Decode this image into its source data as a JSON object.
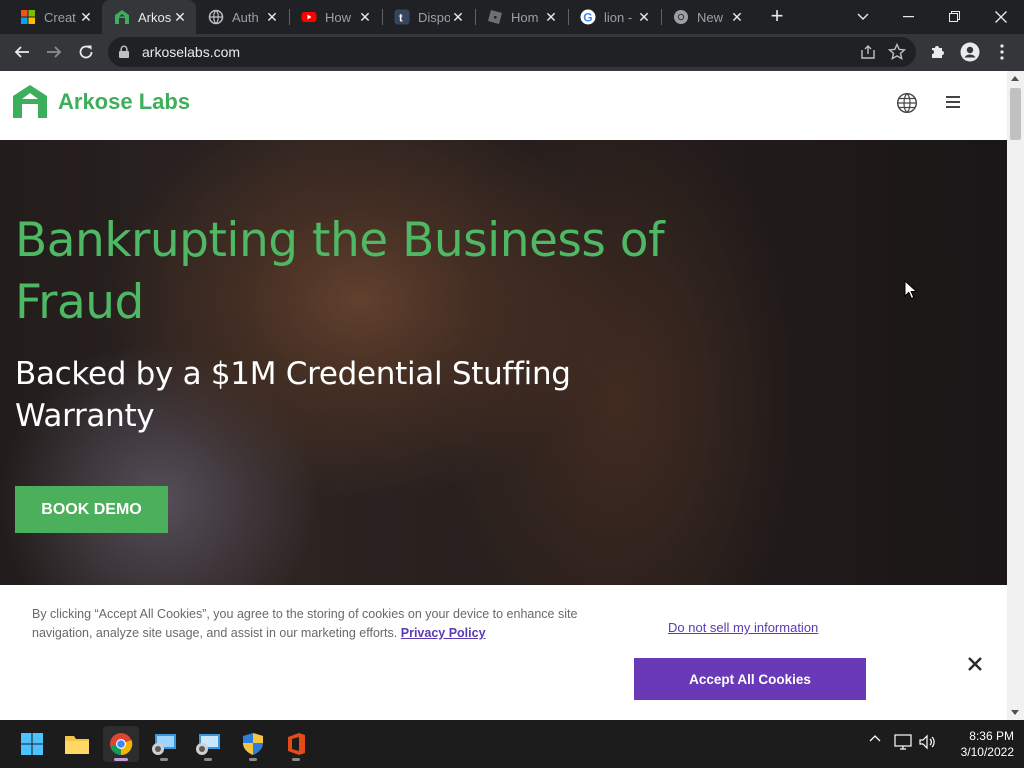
{
  "browser": {
    "tabs": [
      {
        "title": "Creat",
        "favicon": "microsoft-icon",
        "active": false
      },
      {
        "title": "Arkos",
        "favicon": "arkose-icon",
        "active": true
      },
      {
        "title": "Auth",
        "favicon": "globe-icon",
        "active": false
      },
      {
        "title": "How",
        "favicon": "youtube-icon",
        "active": false
      },
      {
        "title": "Dispo",
        "favicon": "tumblr-icon",
        "active": false
      },
      {
        "title": "Hom",
        "favicon": "roblox-icon",
        "active": false
      },
      {
        "title": "lion -",
        "favicon": "google-icon",
        "active": false
      },
      {
        "title": "New",
        "favicon": "chrome-icon",
        "active": false
      }
    ],
    "url": "arkoselabs.com"
  },
  "site": {
    "brand": "Arkose Labs",
    "hero_title": "Bankrupting the Business of Fraud",
    "hero_subtitle": "Backed by a $1M Credential Stuffing Warranty",
    "cta_label": "BOOK DEMO"
  },
  "cookie_banner": {
    "text": "By clicking “Accept All Cookies”, you agree to the storing of cookies on your device to enhance site navigation, analyze site usage, and assist in our marketing efforts.",
    "policy_link": "Privacy Policy",
    "do_not_sell": "Do not sell my information",
    "accept_label": "Accept All Cookies"
  },
  "taskbar": {
    "apps": [
      "windows-start-icon",
      "file-explorer-icon",
      "chrome-icon",
      "remote-desktop-icon",
      "remote-desktop-icon-2",
      "security-shield-icon",
      "office-icon"
    ],
    "time": "8:36 PM",
    "date": "3/10/2022"
  },
  "colors": {
    "brand_green": "#3dae5b",
    "hero_green": "#4fb864",
    "cookie_purple": "#6a39b8"
  }
}
